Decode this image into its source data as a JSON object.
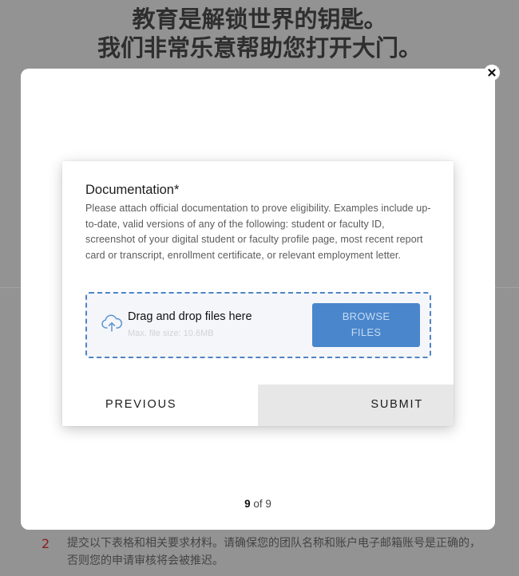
{
  "background": {
    "heading_line1": "教育是解锁世界的钥匙。",
    "heading_line2": "我们非常乐意帮助您打开大门。",
    "step": {
      "number": "2",
      "text": "提交以下表格和相关要求材料。请确保您的团队名称和账户电子邮箱账号是正确的，否则您的申请审核将会被推迟。"
    }
  },
  "modal": {
    "close_icon": "close-icon",
    "documentation": {
      "title": "Documentation*",
      "description": "Please attach official documentation to prove eligibility. Examples include up-to-date, valid versions of any of the following: student or faculty ID, screenshot of your digital student or faculty profile page, most recent report card or transcript, enrollment certificate, or relevant employment letter."
    },
    "dropzone": {
      "icon": "cloud-upload-icon",
      "title": "Drag and drop files here",
      "subtitle": "Max. file size: 10.6MB",
      "browse_line1": "BROWSE",
      "browse_line2": "FILES"
    },
    "buttons": {
      "previous": "PREVIOUS",
      "submit": "SUBMIT"
    },
    "pager": {
      "current": "9",
      "separator": "of",
      "total": "9"
    }
  },
  "colors": {
    "overlay": "#939393",
    "accent": "#4a86cc",
    "dropzone_border": "#4f84c4",
    "step_number": "#8b1d1d"
  }
}
